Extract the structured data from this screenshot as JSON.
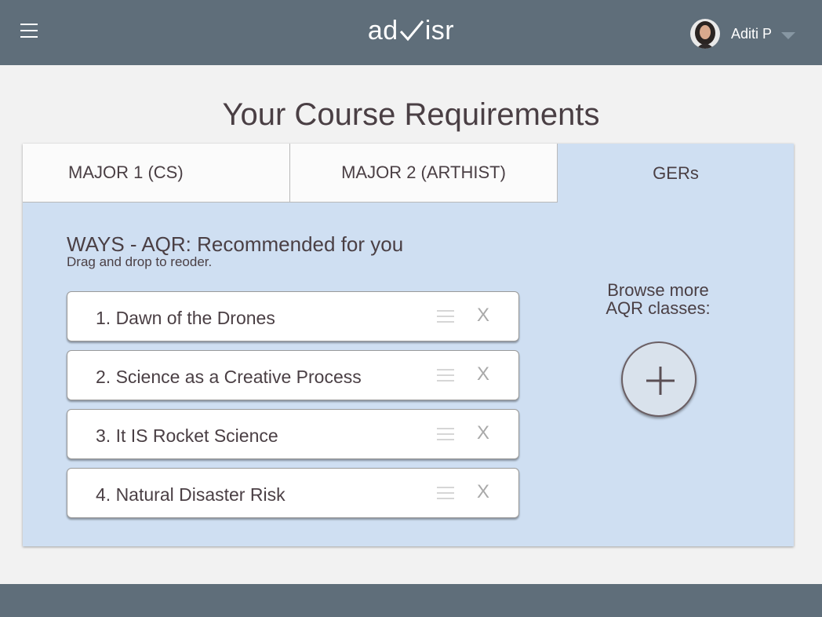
{
  "header": {
    "logo_prefix": "ad",
    "logo_suffix": "isr",
    "user_name": "Aditi P"
  },
  "page": {
    "title": "Your Course Requirements"
  },
  "tabs": [
    {
      "label": "MAJOR 1 (CS)"
    },
    {
      "label": "MAJOR 2 (ARTHIST)"
    },
    {
      "label": "GERs"
    }
  ],
  "section": {
    "title": "WAYS - AQR: Recommended for you",
    "subtitle": "Drag and drop to reoder."
  },
  "courses": [
    {
      "label": "1. Dawn of the Drones",
      "remove": "X"
    },
    {
      "label": "2. Science as a Creative Process",
      "remove": "X"
    },
    {
      "label": "3. It IS Rocket Science",
      "remove": "X"
    },
    {
      "label": "4. Natural Disaster Risk",
      "remove": "X"
    }
  ],
  "browse": {
    "line1": "Browse more",
    "line2": "AQR classes:"
  },
  "colors": {
    "topbar": "#5f6e7a",
    "panel": "#cfdff2",
    "text": "#4a3f44"
  }
}
